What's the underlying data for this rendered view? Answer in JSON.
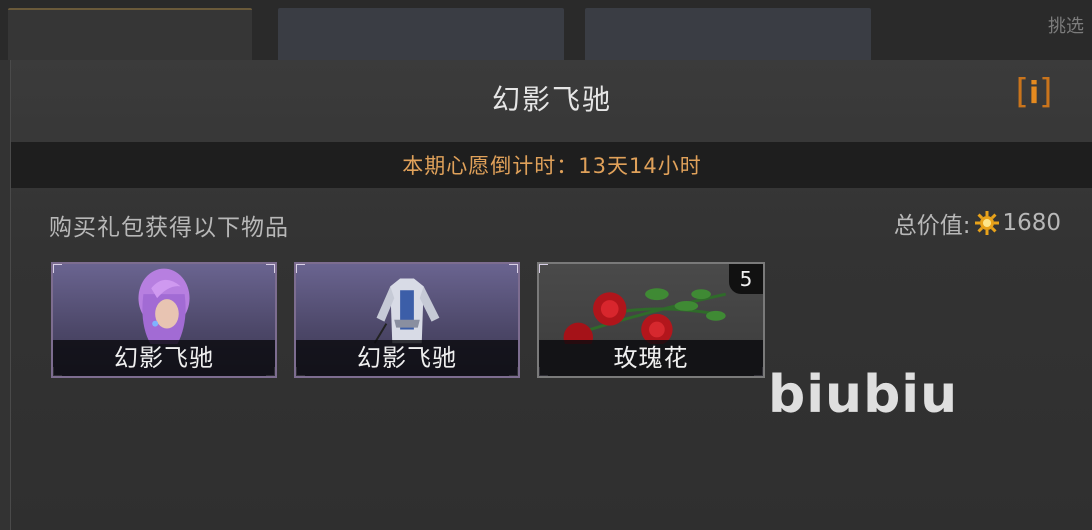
{
  "background": {
    "corner_text": "挑选"
  },
  "dialog": {
    "title": "幻影飞驰",
    "info_label": "i",
    "countdown": "本期心愿倒计时：13天14小时",
    "gift_label": "购买礼包获得以下物品",
    "total_value_label": "总价值:",
    "total_value": "1680",
    "items": [
      {
        "name": "幻影飞驰",
        "rarity": "purple",
        "icon": "character-hair-icon"
      },
      {
        "name": "幻影飞驰",
        "rarity": "purple",
        "icon": "outfit-icon"
      },
      {
        "name": "玫瑰花",
        "rarity": "grey",
        "icon": "rose-icon",
        "quantity": "5"
      }
    ]
  },
  "watermark": "biubiu",
  "colors": {
    "accent_orange": "#e58a1f",
    "countdown_text": "#e0a15a",
    "purple_rarity": "#6a6490"
  }
}
